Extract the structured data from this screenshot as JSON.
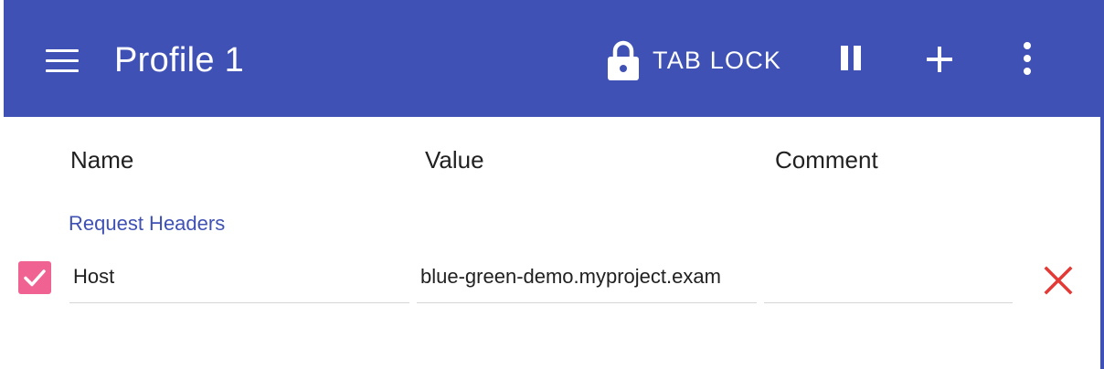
{
  "appbar": {
    "title": "Profile 1",
    "tab_lock_label": "TAB LOCK",
    "background": "#3f51b5",
    "icons": {
      "menu": "hamburger-menu-icon",
      "lock": "lock-icon",
      "pause": "pause-icon",
      "add": "plus-icon",
      "more": "more-vert-icon"
    }
  },
  "columns": {
    "name": "Name",
    "value": "Value",
    "comment": "Comment"
  },
  "section": {
    "label": "Request Headers",
    "color": "#3f51b5"
  },
  "rows": [
    {
      "checked": true,
      "name": "Host",
      "value": "blue-green-demo.myproject.exam",
      "comment": "",
      "checkbox_color": "#f06292",
      "delete_icon": "close-icon",
      "delete_color": "#e53935"
    }
  ]
}
